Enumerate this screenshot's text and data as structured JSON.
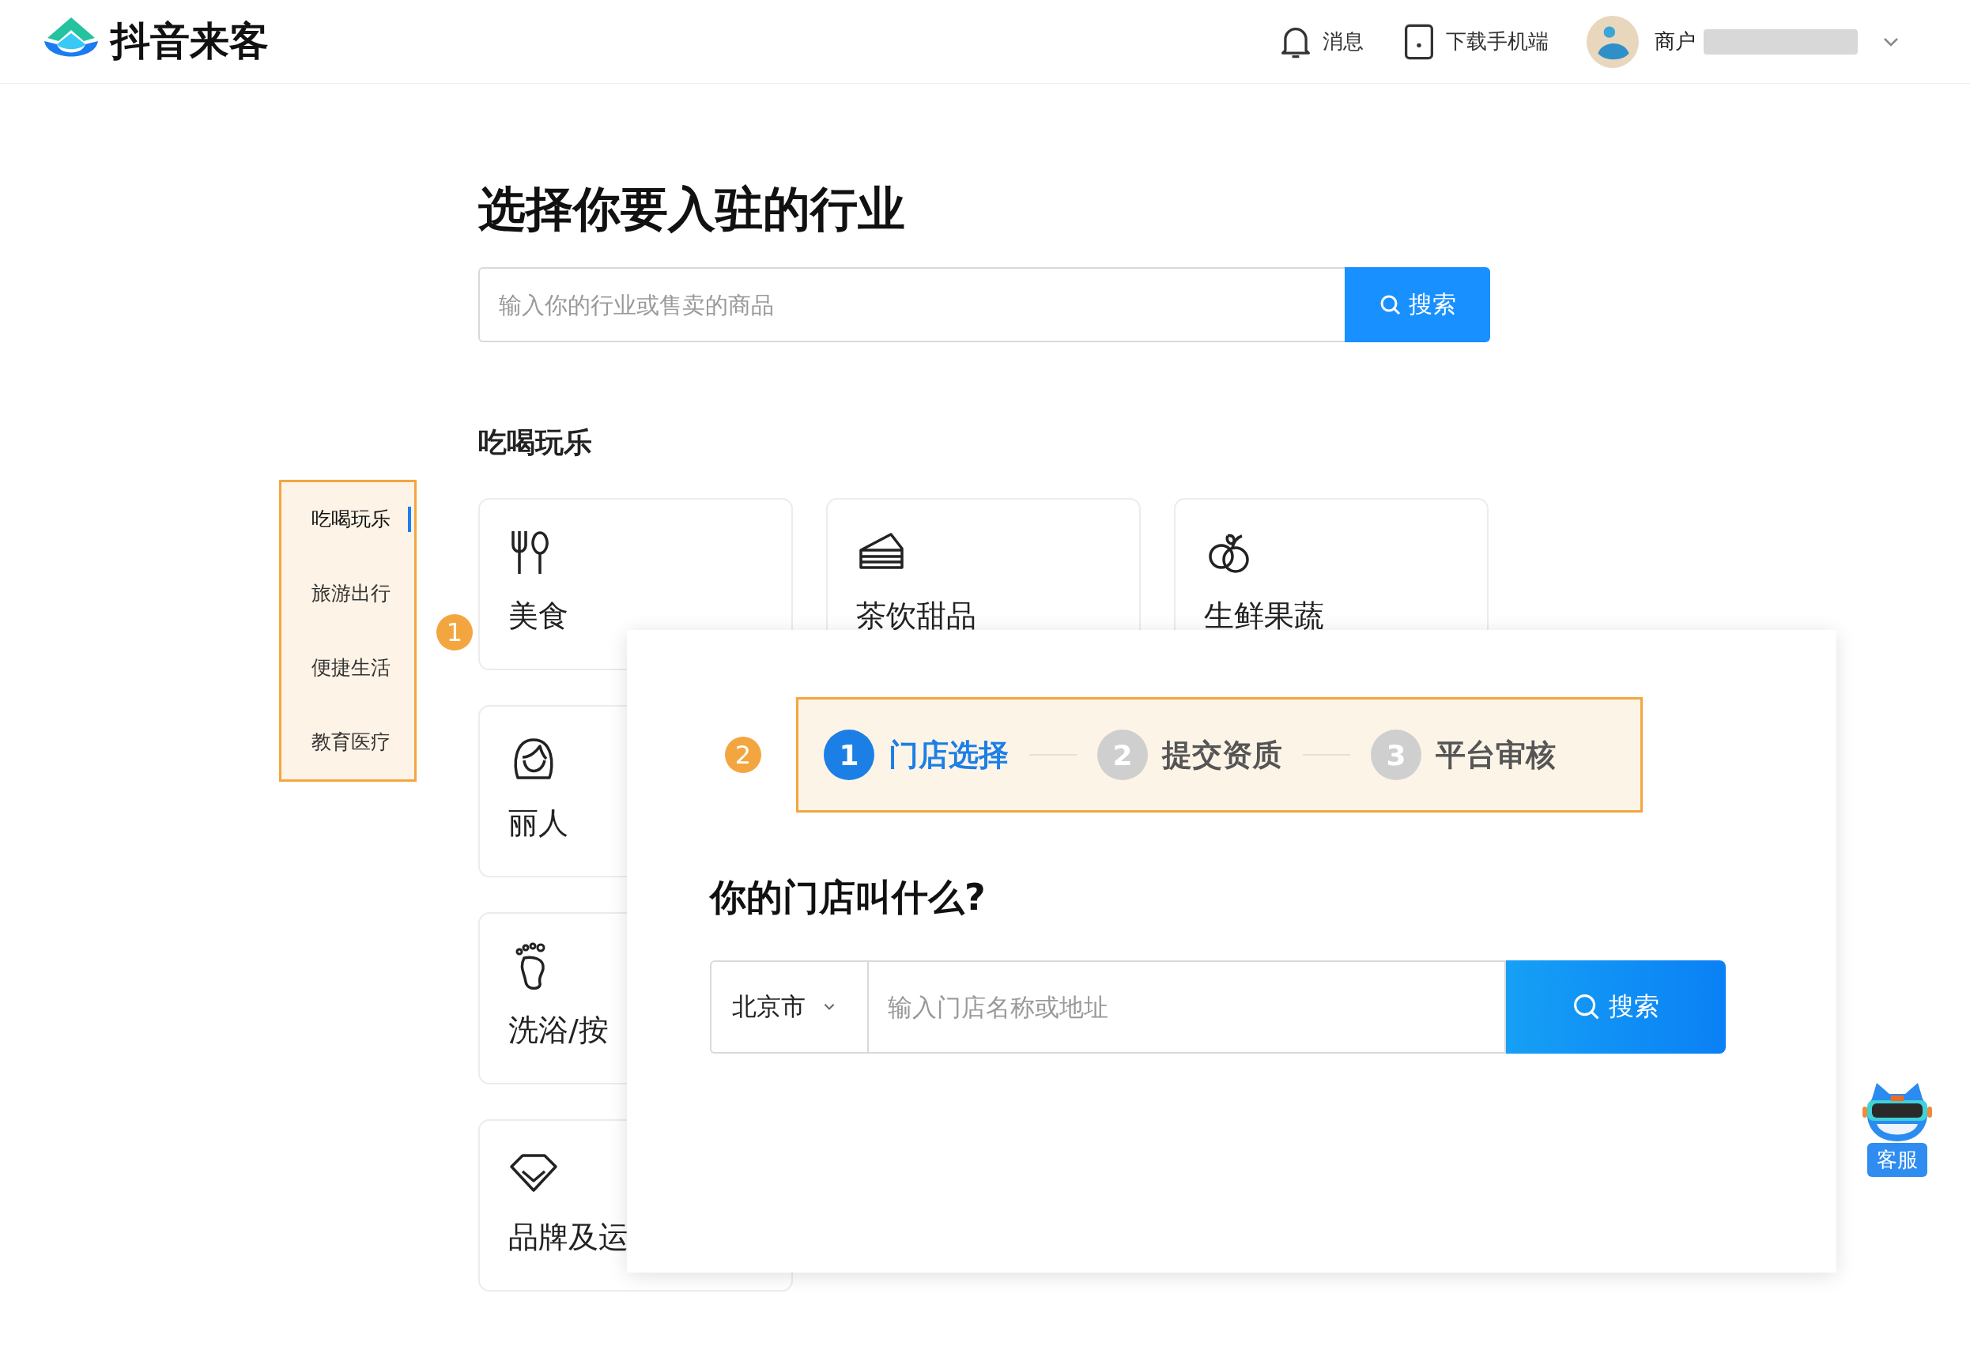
{
  "header": {
    "logo_text": "抖音来客",
    "nav": [
      {
        "kind": "bell",
        "label": "消息"
      },
      {
        "kind": "phone",
        "label": "下载手机端"
      }
    ],
    "user": {
      "name": "商户"
    }
  },
  "title": "选择你要入驻的行业",
  "search": {
    "placeholder": "输入你的行业或售卖的商品",
    "button": "搜索"
  },
  "sidebar": [
    {
      "label": "吃喝玩乐",
      "selected": true
    },
    {
      "label": "旅游出行",
      "selected": false
    },
    {
      "label": "便捷生活",
      "selected": false
    },
    {
      "label": "教育医疗",
      "selected": false
    }
  ],
  "section_title": "吃喝玩乐",
  "cards": [
    {
      "kind": "food",
      "label": "美食"
    },
    {
      "kind": "cake",
      "label": "茶饮甜品"
    },
    {
      "kind": "fruit",
      "label": "生鲜果蔬"
    },
    {
      "kind": "beauty",
      "label": "丽人"
    },
    {
      "kind": "foot",
      "label": "洗浴/按"
    },
    {
      "kind": "gem",
      "label": "品牌及运"
    }
  ],
  "markers": [
    "1",
    "2"
  ],
  "dialog": {
    "steps": [
      {
        "number": "1",
        "label": "门店选择",
        "selected": true
      },
      {
        "number": "2",
        "label": "提交资质",
        "selected": false
      },
      {
        "number": "3",
        "label": "平台审核",
        "selected": false
      }
    ],
    "question": "你的门店叫什么?",
    "city": "北京市",
    "placeholder": "输入门店名称或地址",
    "button": "搜索"
  },
  "support": {
    "label": "客服"
  }
}
